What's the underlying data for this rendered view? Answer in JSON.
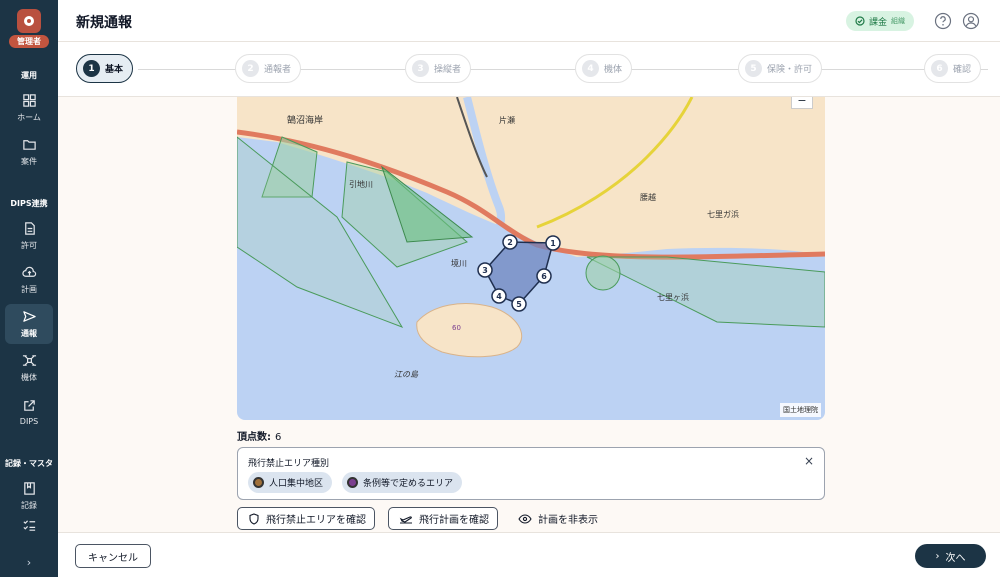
{
  "sidebar": {
    "role": "管理者",
    "sections": [
      {
        "label": "運用"
      },
      {
        "label": "DIPS連携"
      },
      {
        "label": "記録・マスタ"
      }
    ],
    "items": [
      {
        "label": "ホーム",
        "icon": "grid-icon"
      },
      {
        "label": "案件",
        "icon": "folder-icon"
      },
      {
        "label": "許可",
        "icon": "document-icon"
      },
      {
        "label": "計画",
        "icon": "cloud-upload-icon"
      },
      {
        "label": "通報",
        "icon": "send-icon",
        "active": true
      },
      {
        "label": "機体",
        "icon": "drone-icon"
      },
      {
        "label": "DIPS",
        "icon": "external-link-icon"
      },
      {
        "label": "記録",
        "icon": "book-icon"
      },
      {
        "label": "",
        "icon": "checklist-icon"
      }
    ],
    "expand": "›"
  },
  "header": {
    "title": "新規通報",
    "billing_label": "課金",
    "billing_sub": "組織"
  },
  "steps": [
    {
      "num": "1",
      "label": "基本",
      "active": true
    },
    {
      "num": "2",
      "label": "通報者"
    },
    {
      "num": "3",
      "label": "操縦者"
    },
    {
      "num": "4",
      "label": "機体"
    },
    {
      "num": "5",
      "label": "保険・許可"
    },
    {
      "num": "6",
      "label": "確認"
    }
  ],
  "map": {
    "labels": {
      "kugenuma": "鵠沼海岸",
      "katase": "片瀬",
      "koshigoe": "腰越",
      "shichirigahama1": "七里ガ浜",
      "shichirigahama2": "七里ヶ浜",
      "sakaigawa": "境川",
      "hikichigawa": "引地川",
      "enoshima": "江の島",
      "elevation": "60",
      "attribution": "国土地理院"
    },
    "vertices": [
      "1",
      "2",
      "3",
      "4",
      "5",
      "6"
    ]
  },
  "vertex_count": {
    "label": "頂点数:",
    "value": "6"
  },
  "legend": {
    "title": "飛行禁止エリア種別",
    "close": "×",
    "chips": [
      {
        "label": "人口集中地区",
        "color": "#a0703a"
      },
      {
        "label": "条例等で定めるエリア",
        "color": "#7b3f8f"
      }
    ]
  },
  "actions": {
    "check_area": "飛行禁止エリアを確認",
    "check_plan": "飛行計画を確認",
    "hide_plan": "計画を非表示"
  },
  "footer": {
    "cancel": "キャンセル",
    "next": "次へ"
  }
}
